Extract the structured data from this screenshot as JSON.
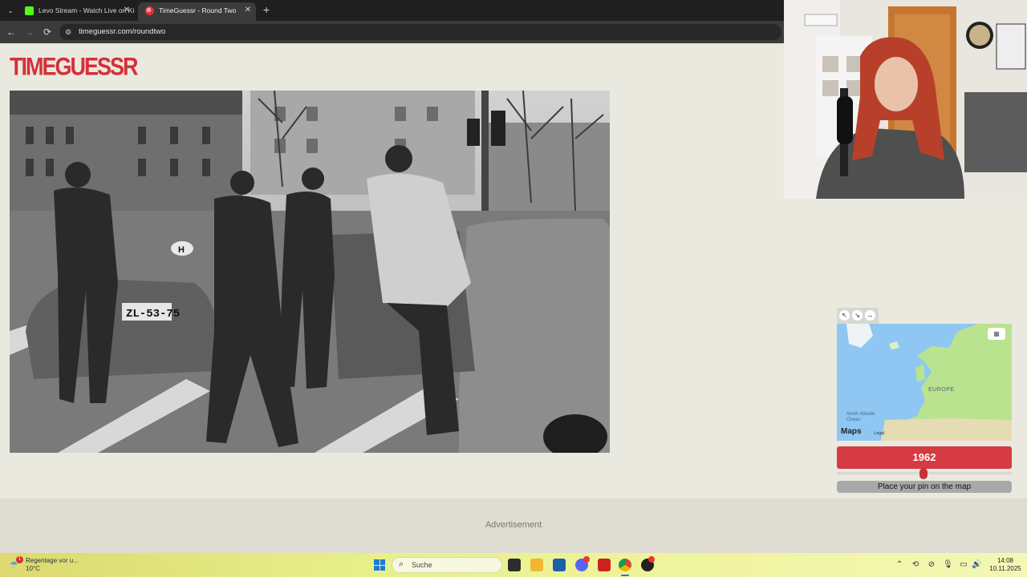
{
  "browser": {
    "tabs": [
      {
        "title": "Levo Stream - Watch Live on Ki",
        "active": false
      },
      {
        "title": "TimeGuessr - Round Two",
        "active": true
      }
    ],
    "url": "timeguessr.com/roundtwo",
    "new_tab_glyph": "+",
    "close_glyph": "✕"
  },
  "page": {
    "logo_text": "TIMEGUESSR",
    "photo": {
      "plate": "ZL-53-75",
      "sticker": "H"
    },
    "map": {
      "region_label": "EUROPE",
      "ocean_label": "North Atlantic Ocean",
      "attribution": "Maps",
      "legal": "Legal",
      "tools": [
        "arrow-expand-icon",
        "arrow-collapse-icon",
        "arrows-horizontal-icon"
      ],
      "expand_icon": "map-icon",
      "land_color": "#b9e38f",
      "water_color": "#8fc7f2"
    },
    "year_value": "1962",
    "slider_fraction": 0.49,
    "pin_button_label": "Place your pin on the map",
    "ad_label": "Advertisement",
    "accent_color": "#d53a43"
  },
  "taskbar": {
    "weather_title": "Regentage vor u...",
    "weather_temp": "10°C",
    "weather_badge": "1",
    "search_placeholder": "Suche",
    "apps": [
      "task-view-icon",
      "file-explorer-icon",
      "store-icon",
      "discord-icon",
      "voice-app-icon",
      "chrome-icon",
      "app-icon"
    ],
    "time": "14:08",
    "date": "10.11.2025"
  }
}
